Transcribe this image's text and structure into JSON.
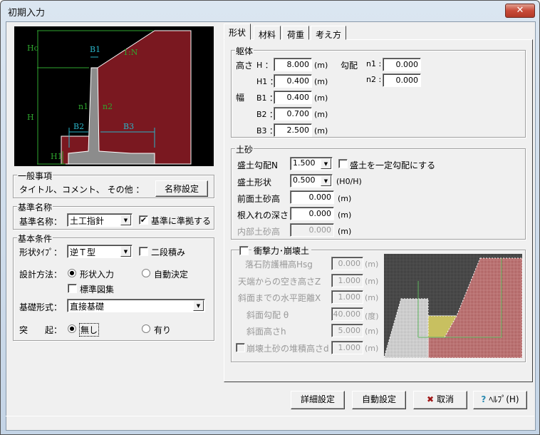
{
  "window": {
    "title": "初期入力",
    "close": "✕"
  },
  "diagram": {
    "labels": {
      "ho": "Ho",
      "h": "H",
      "h1": "H1",
      "b1": "B1",
      "b2": "B2",
      "b3": "B3",
      "n1": "n1",
      "n2": "n2",
      "slope": "1:N"
    },
    "colors": {
      "soil": "#7a1820",
      "wall": "#8c8c8c",
      "dim": "#2fa82f",
      "dim2": "#2ab4c8"
    }
  },
  "general": {
    "legend": "一般事項",
    "label": "タイトル、コメント、 その他 ：",
    "button": "名称設定"
  },
  "standard": {
    "legend": "基準名称",
    "label": "基準名称：",
    "value": "土工指針",
    "check_label": "基準に準拠する",
    "checked": true
  },
  "basic": {
    "legend": "基本条件",
    "shape_label": "形状ﾀｲﾌﾟ：",
    "shape_value": "逆Ｔ型",
    "two_stage": "二段積み",
    "method_label": "設計方法：",
    "method_opt1": "形状入力",
    "method_opt2": "自動決定",
    "standard_fig": "標準図集",
    "foundation_label": "基礎形式：",
    "foundation_value": "直接基礎",
    "protrusion_label": "突　　起：",
    "prot_opt1": "無し",
    "prot_opt2": "有り"
  },
  "tabs": [
    "形状",
    "材料",
    "荷重",
    "考え方"
  ],
  "body": {
    "legend": "躯体",
    "height": "高さ",
    "width": "幅",
    "slope": "勾配",
    "fields": [
      {
        "label": "H ：",
        "value": "8.000",
        "unit": "(m)"
      },
      {
        "label": "H1 ：",
        "value": "0.400",
        "unit": "(m)"
      },
      {
        "label": "B1 ：",
        "value": "0.400",
        "unit": "(m)"
      },
      {
        "label": "B2 ：",
        "value": "0.700",
        "unit": "(m)"
      },
      {
        "label": "B3 ：",
        "value": "2.500",
        "unit": "(m)"
      }
    ],
    "n1_label": "n1 :",
    "n1": "0.000",
    "n2_label": "n2 :",
    "n2": "0.000"
  },
  "soil": {
    "legend": "土砂",
    "slope_label": "盛土勾配N",
    "slope_value": "1.500",
    "const_slope": "盛土を一定勾配にする",
    "shape_label": "盛土形状",
    "shape_value": "0.500",
    "shape_unit": "(H0/H)",
    "front_label": "前面土砂高",
    "front": "0.000",
    "embed_label": "根入れの深さ",
    "embed": "0.000",
    "inner_label": "内部土砂高",
    "inner": "0.000",
    "unit": "(m)"
  },
  "impact": {
    "legend": "衝撃力･崩壊土",
    "rows": [
      {
        "label": "落石防護柵高Hsg",
        "value": "0.000",
        "unit": "(m)"
      },
      {
        "label": "天端からの空き高さZ",
        "value": "1.000",
        "unit": "(m)"
      },
      {
        "label": "斜面までの水平距離X",
        "value": "1.000",
        "unit": "(m)"
      },
      {
        "label": "斜面勾配 θ",
        "value": "40.000",
        "unit": "(度)"
      },
      {
        "label": "斜面高さh",
        "value": "5.000",
        "unit": "(m)"
      },
      {
        "label": "崩壊土砂の堆積高さd",
        "value": "1.000",
        "unit": "(m)"
      }
    ]
  },
  "buttons": {
    "detail": "詳細設定",
    "auto": "自動設定",
    "cancel": "取消",
    "help": "ﾍﾙﾌﾟ(H)"
  }
}
